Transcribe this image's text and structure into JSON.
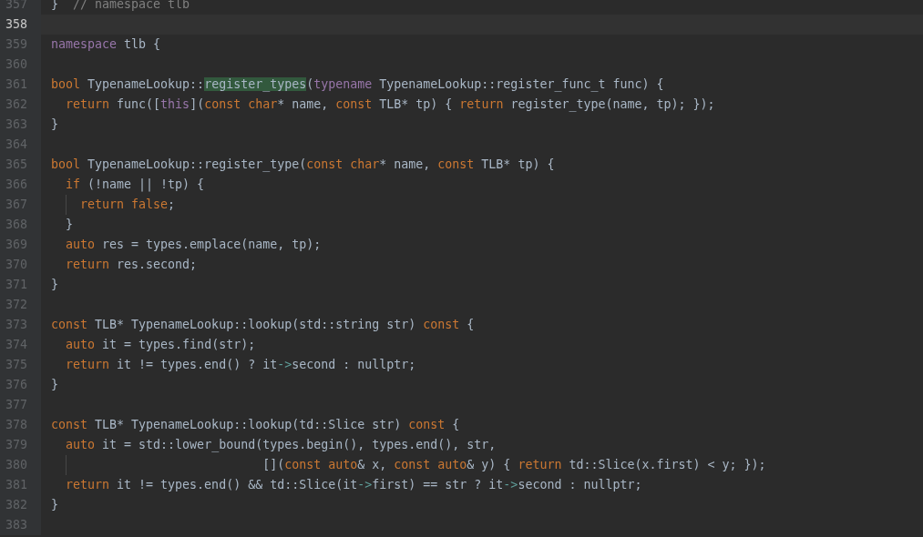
{
  "editor": {
    "lines": [
      {
        "number": "357",
        "current": false,
        "tokens": [
          {
            "kind": "plain",
            "text": "}  "
          },
          {
            "kind": "comment",
            "text": "// namespace tlb"
          }
        ]
      },
      {
        "number": "358",
        "current": true
      },
      {
        "number": "359",
        "current": false,
        "tokens": [
          {
            "kind": "special",
            "text": "namespace"
          },
          {
            "kind": "plain",
            "text": " tlb {"
          }
        ]
      },
      {
        "number": "360",
        "current": false
      },
      {
        "number": "361",
        "current": false,
        "tokens": [
          {
            "kind": "keyword",
            "text": "bool"
          },
          {
            "kind": "plain",
            "text": " TypenameLookup::"
          },
          {
            "kind": "match",
            "text": "register_types"
          },
          {
            "kind": "plain",
            "text": "("
          },
          {
            "kind": "special",
            "text": "typename"
          },
          {
            "kind": "plain",
            "text": " TypenameLookup::register_func_t func) {"
          }
        ]
      },
      {
        "number": "362",
        "current": false,
        "tokens": [
          {
            "kind": "keyword",
            "text": "  return"
          },
          {
            "kind": "plain",
            "text": " func(["
          },
          {
            "kind": "special",
            "text": "this"
          },
          {
            "kind": "plain",
            "text": "]("
          },
          {
            "kind": "keyword",
            "text": "const char"
          },
          {
            "kind": "plain",
            "text": "* name, "
          },
          {
            "kind": "keyword",
            "text": "const"
          },
          {
            "kind": "plain",
            "text": " TLB* tp) { "
          },
          {
            "kind": "keyword",
            "text": "return"
          },
          {
            "kind": "plain",
            "text": " register_type(name, tp); });"
          }
        ]
      },
      {
        "number": "363",
        "current": false,
        "tokens": [
          {
            "kind": "plain",
            "text": "}"
          }
        ]
      },
      {
        "number": "364",
        "current": false
      },
      {
        "number": "365",
        "current": false,
        "tokens": [
          {
            "kind": "keyword",
            "text": "bool"
          },
          {
            "kind": "plain",
            "text": " TypenameLookup::register_type("
          },
          {
            "kind": "keyword",
            "text": "const char"
          },
          {
            "kind": "plain",
            "text": "* name, "
          },
          {
            "kind": "keyword",
            "text": "const"
          },
          {
            "kind": "plain",
            "text": " TLB* tp) {"
          }
        ]
      },
      {
        "number": "366",
        "current": false,
        "tokens": [
          {
            "kind": "keyword",
            "text": "  if"
          },
          {
            "kind": "plain",
            "text": " (!name || !tp) {"
          }
        ]
      },
      {
        "number": "367",
        "current": false,
        "guide": true,
        "tokens": [
          {
            "kind": "keyword",
            "text": "    return false"
          },
          {
            "kind": "plain",
            "text": ";"
          }
        ]
      },
      {
        "number": "368",
        "current": false,
        "tokens": [
          {
            "kind": "plain",
            "text": "  }"
          }
        ]
      },
      {
        "number": "369",
        "current": false,
        "tokens": [
          {
            "kind": "keyword",
            "text": "  auto"
          },
          {
            "kind": "plain",
            "text": " res = types.emplace(name, tp);"
          }
        ]
      },
      {
        "number": "370",
        "current": false,
        "tokens": [
          {
            "kind": "keyword",
            "text": "  return"
          },
          {
            "kind": "plain",
            "text": " res.second;"
          }
        ]
      },
      {
        "number": "371",
        "current": false,
        "tokens": [
          {
            "kind": "plain",
            "text": "}"
          }
        ]
      },
      {
        "number": "372",
        "current": false
      },
      {
        "number": "373",
        "current": false,
        "tokens": [
          {
            "kind": "keyword",
            "text": "const"
          },
          {
            "kind": "plain",
            "text": " TLB* TypenameLookup::lookup(std::string str) "
          },
          {
            "kind": "keyword",
            "text": "const"
          },
          {
            "kind": "plain",
            "text": " {"
          }
        ]
      },
      {
        "number": "374",
        "current": false,
        "tokens": [
          {
            "kind": "keyword",
            "text": "  auto"
          },
          {
            "kind": "plain",
            "text": " it = types.find(str);"
          }
        ]
      },
      {
        "number": "375",
        "current": false,
        "tokens": [
          {
            "kind": "keyword",
            "text": "  return"
          },
          {
            "kind": "plain",
            "text": " it != types.end() ? it"
          },
          {
            "kind": "operator",
            "text": "->"
          },
          {
            "kind": "plain",
            "text": "second : nullptr;"
          }
        ]
      },
      {
        "number": "376",
        "current": false,
        "tokens": [
          {
            "kind": "plain",
            "text": "}"
          }
        ]
      },
      {
        "number": "377",
        "current": false
      },
      {
        "number": "378",
        "current": false,
        "tokens": [
          {
            "kind": "keyword",
            "text": "const"
          },
          {
            "kind": "plain",
            "text": " TLB* TypenameLookup::lookup(td::Slice str) "
          },
          {
            "kind": "keyword",
            "text": "const"
          },
          {
            "kind": "plain",
            "text": " {"
          }
        ]
      },
      {
        "number": "379",
        "current": false,
        "tokens": [
          {
            "kind": "keyword",
            "text": "  auto"
          },
          {
            "kind": "plain",
            "text": " it = std::lower_bound(types.begin(), types.end(), str,"
          }
        ]
      },
      {
        "number": "380",
        "current": false,
        "guide": true,
        "tokens": [
          {
            "kind": "plain",
            "text": "                             []("
          },
          {
            "kind": "keyword",
            "text": "const auto"
          },
          {
            "kind": "plain",
            "text": "& x, "
          },
          {
            "kind": "keyword",
            "text": "const auto"
          },
          {
            "kind": "plain",
            "text": "& y) { "
          },
          {
            "kind": "keyword",
            "text": "return"
          },
          {
            "kind": "plain",
            "text": " td::Slice(x.first) < y; });"
          }
        ]
      },
      {
        "number": "381",
        "current": false,
        "tokens": [
          {
            "kind": "keyword",
            "text": "  return"
          },
          {
            "kind": "plain",
            "text": " it != types.end() && td::Slice(it"
          },
          {
            "kind": "operator",
            "text": "->"
          },
          {
            "kind": "plain",
            "text": "first) == str ? it"
          },
          {
            "kind": "operator",
            "text": "->"
          },
          {
            "kind": "plain",
            "text": "second : nullptr;"
          }
        ]
      },
      {
        "number": "382",
        "current": false,
        "tokens": [
          {
            "kind": "plain",
            "text": "}"
          }
        ]
      },
      {
        "number": "383",
        "current": false
      }
    ]
  }
}
